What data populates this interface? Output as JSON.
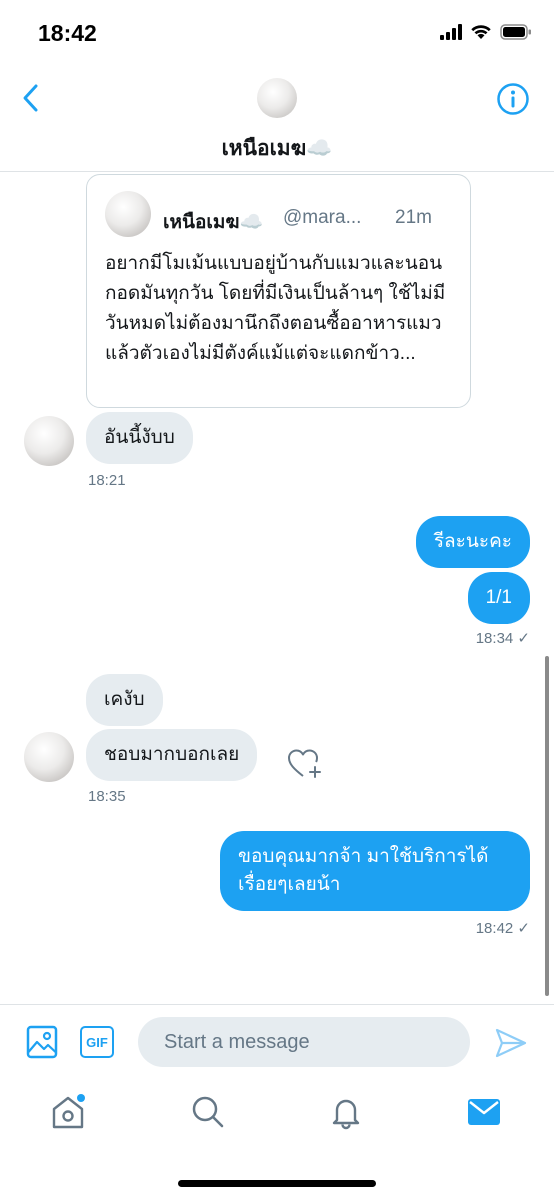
{
  "status_bar": {
    "time": "18:42",
    "icons": [
      "cellular-signal-icon",
      "wifi-icon",
      "battery-icon"
    ]
  },
  "header": {
    "contact_name": "เหนือเมฆ☁️",
    "icons": [
      "back-chevron-icon",
      "info-icon"
    ]
  },
  "messages": {
    "quoted_tweet": {
      "author_name": "เหนือเมฆ☁️",
      "handle": "@mara...",
      "time": "21m",
      "text": "อยากมีโมเม้นแบบอยู่บ้านกับแมวและนอนกอดมันทุกวัน โดยที่มีเงินเป็นล้านๆ ใช้ไม่มีวันหมดไม่ต้องมานึกถึงตอนซื้ออาหารแมวแล้วตัวเองไม่มีตังค์แม้แต่จะแดกข้าว..."
    },
    "incoming_1": "อันนี้งับบ",
    "incoming_1_time": "18:21",
    "outgoing_1": "รีละนะคะ",
    "outgoing_2": "1/1",
    "outgoing_2_time": "18:34 ✓",
    "incoming_2": "เคงับ",
    "incoming_3": "ชอบมากบอกเลย",
    "incoming_3_time": "18:35",
    "outgoing_3": "ขอบคุณมากจ้า มาใช้บริการได้เรื่อยๆเลยน้า",
    "outgoing_3_time": "18:42 ✓"
  },
  "composer": {
    "placeholder": "Start a message",
    "gif_label": "GIF",
    "icons": [
      "image-icon",
      "gif-icon",
      "send-icon"
    ]
  },
  "tab_bar": {
    "tabs": [
      "home-icon",
      "search-icon",
      "notifications-bell-icon",
      "messages-mail-icon"
    ],
    "active_tab": "messages-mail-icon"
  },
  "colors": {
    "accent": "#1da1f2",
    "incoming_bubble": "#e6ecf0",
    "secondary_text": "#657786"
  }
}
